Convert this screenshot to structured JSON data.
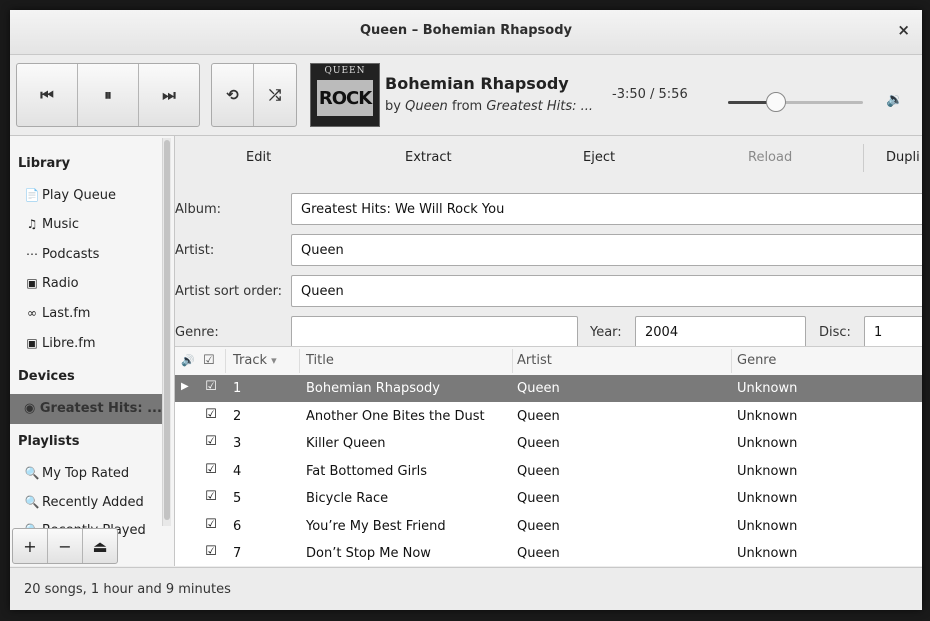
{
  "window": {
    "title": "Queen – Bohemian Rhapsody",
    "close_symbol": "×"
  },
  "player": {
    "prev_symbol": "⏮",
    "pause_symbol": "⏸",
    "next_symbol": "⏭",
    "repeat_symbol": "⟲",
    "shuffle_symbol": "⤮",
    "cover_top": "QUEEN",
    "cover_main": "ROCK",
    "song_title": "Bohemian Rhapsody",
    "by_word": "by",
    "artist": "Queen",
    "from_word": "from",
    "album_short": "Greatest Hits: ...",
    "time": "-3:50 / 5:56",
    "progress": 0.35,
    "volume_symbol": "🔉"
  },
  "sidebar": {
    "library_header": "Library",
    "library_items": [
      {
        "label": "Play Queue",
        "icon": "📄"
      },
      {
        "label": "Music",
        "icon": "♫"
      },
      {
        "label": "Podcasts",
        "icon": "⋯"
      },
      {
        "label": "Radio",
        "icon": "▣"
      },
      {
        "label": "Last.fm",
        "icon": "∞"
      },
      {
        "label": "Libre.fm",
        "icon": "▣"
      }
    ],
    "devices_header": "Devices",
    "device_selected": {
      "label": "Greatest Hits: ...",
      "icon": "◉"
    },
    "playlists_header": "Playlists",
    "playlist_items": [
      {
        "label": "My Top Rated",
        "icon": "🔍"
      },
      {
        "label": "Recently Added",
        "icon": "🔍"
      },
      {
        "label": "Recently Played",
        "icon": "🔍"
      }
    ],
    "add_symbol": "+",
    "remove_symbol": "−",
    "eject_symbol": "⏏"
  },
  "actions": {
    "edit": "Edit",
    "extract": "Extract",
    "eject": "Eject",
    "reload": "Reload",
    "duplicate": "Dupli"
  },
  "form": {
    "album_label": "Album:",
    "album_value": "Greatest Hits: We Will Rock You",
    "artist_label": "Artist:",
    "artist_value": "Queen",
    "artist_sort_label": "Artist sort order:",
    "artist_sort_value": "Queen",
    "genre_label": "Genre:",
    "genre_value": "",
    "year_label": "Year:",
    "year_value": "2004",
    "disc_label": "Disc:",
    "disc_value": "1"
  },
  "table": {
    "columns": {
      "speaker": "🔊",
      "check": "☑",
      "track": "Track",
      "sort_arrow": "▾",
      "title": "Title",
      "artist": "Artist",
      "genre": "Genre"
    },
    "rows": [
      {
        "track": "1",
        "title": "Bohemian Rhapsody",
        "artist": "Queen",
        "genre": "Unknown",
        "playing": true,
        "checked": true
      },
      {
        "track": "2",
        "title": "Another One Bites the Dust",
        "artist": "Queen",
        "genre": "Unknown",
        "playing": false,
        "checked": true
      },
      {
        "track": "3",
        "title": "Killer Queen",
        "artist": "Queen",
        "genre": "Unknown",
        "playing": false,
        "checked": true
      },
      {
        "track": "4",
        "title": "Fat Bottomed Girls",
        "artist": "Queen",
        "genre": "Unknown",
        "playing": false,
        "checked": true
      },
      {
        "track": "5",
        "title": "Bicycle Race",
        "artist": "Queen",
        "genre": "Unknown",
        "playing": false,
        "checked": true
      },
      {
        "track": "6",
        "title": "You’re My Best Friend",
        "artist": "Queen",
        "genre": "Unknown",
        "playing": false,
        "checked": true
      },
      {
        "track": "7",
        "title": "Don’t Stop Me Now",
        "artist": "Queen",
        "genre": "Unknown",
        "playing": false,
        "checked": true
      }
    ],
    "play_symbol": "▶",
    "check_symbol": "☑"
  },
  "status": {
    "text": "20 songs, 1 hour and 9 minutes"
  }
}
